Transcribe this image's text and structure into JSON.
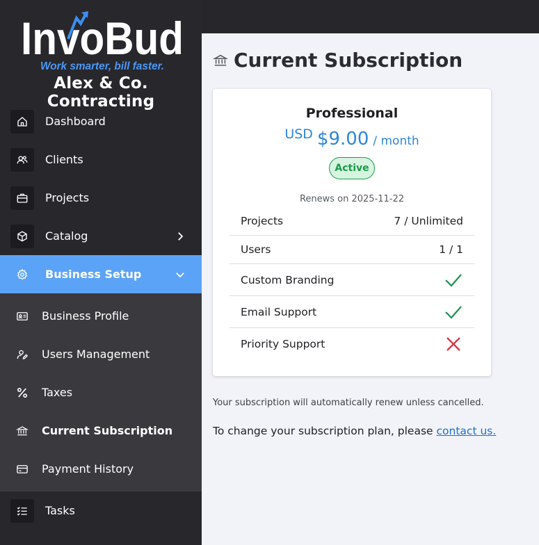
{
  "brand": {
    "logo_text": "InvoBud",
    "tagline": "Work smarter, bill faster.",
    "company_name": "Alex & Co. Contracting",
    "accent_color": "#5ba3f6"
  },
  "nav": [
    {
      "label": "Dashboard",
      "icon": "home-icon"
    },
    {
      "label": "Clients",
      "icon": "users-icon"
    },
    {
      "label": "Projects",
      "icon": "briefcase-icon"
    },
    {
      "label": "Catalog",
      "icon": "box-icon",
      "chevron": "chevron-right-icon"
    },
    {
      "label": "Business Setup",
      "icon": "gear-icon",
      "chevron": "chevron-down-icon",
      "active": true
    }
  ],
  "submenu": [
    {
      "label": "Business Profile",
      "icon": "id-card-icon"
    },
    {
      "label": "Users Management",
      "icon": "user-edit-icon"
    },
    {
      "label": "Taxes",
      "icon": "percent-icon"
    },
    {
      "label": "Current Subscription",
      "icon": "bank-icon",
      "current": true
    },
    {
      "label": "Payment History",
      "icon": "credit-card-icon"
    }
  ],
  "nav_bottom": {
    "label": "Tasks",
    "icon": "checklist-icon"
  },
  "page": {
    "title": "Current Subscription",
    "title_icon": "bank-icon"
  },
  "subscription": {
    "plan_name": "Professional",
    "currency": "USD",
    "amount": "$9.00",
    "period": "/ month",
    "status": "Active",
    "renews": "Renews on 2025-11-22",
    "features": [
      {
        "name": "Projects",
        "value": "7 / Unlimited",
        "type": "text"
      },
      {
        "name": "Users",
        "value": "1 / 1",
        "type": "text"
      },
      {
        "name": "Custom Branding",
        "type": "check"
      },
      {
        "name": "Email Support",
        "type": "check"
      },
      {
        "name": "Priority Support",
        "type": "cross"
      }
    ],
    "check_color": "#1f8f4e",
    "cross_color": "#d9374a"
  },
  "footer": {
    "auto_renew_note": "Your subscription will automatically renew unless cancelled.",
    "change_text": "To change your subscription plan, please ",
    "contact_link": "contact us."
  }
}
